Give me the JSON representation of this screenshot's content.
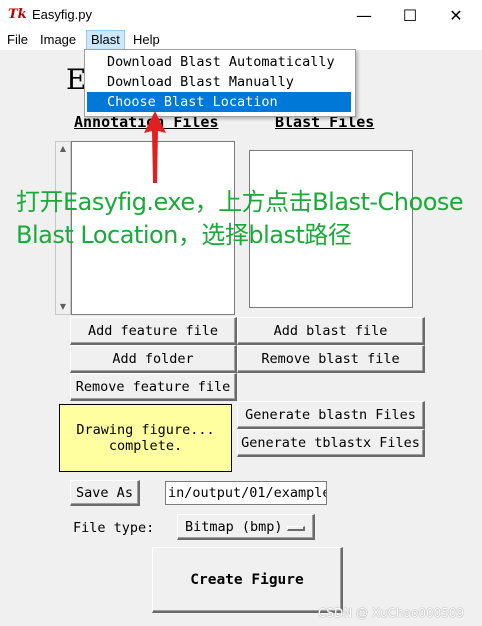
{
  "window": {
    "app_icon": "Tk",
    "title": "Easyfig.py",
    "minimize": "—",
    "maximize": "☐",
    "close": "✕"
  },
  "menubar": {
    "items": [
      "File",
      "Image",
      "Blast",
      "Help"
    ],
    "active": "Blast"
  },
  "blast_menu": {
    "items": [
      "Download Blast Automatically",
      "Download Blast Manually",
      "Choose Blast Location"
    ],
    "selected": "Choose Blast Location"
  },
  "main": {
    "title_partial": "E",
    "annotation_header": "Annotation Files",
    "blast_header": "Blast Files",
    "scroll_up": "▲",
    "scroll_down": "▼"
  },
  "buttons": {
    "add_feature_file": "Add feature file",
    "add_blast_file": "Add blast file",
    "add_folder": "Add folder",
    "remove_blast_file": "Remove blast file",
    "remove_feature_file": "Remove feature file",
    "generate_blastn": "Generate blastn Files",
    "generate_tblastx": "Generate tblastx Files",
    "save_as": "Save As",
    "create_figure": "Create Figure"
  },
  "status": {
    "line1": "Drawing figure...",
    "line2": "complete."
  },
  "save_path": "in/output/01/example",
  "file_type": {
    "label": "File type:",
    "selected": "Bitmap (bmp)"
  },
  "annotation_overlay": {
    "text": "打开Easyfig.exe，上方点击Blast-Choose\nBlast Location，选择blast路径",
    "color": "#1aaa3a",
    "arrow_color": "#e02020"
  },
  "watermark": "CSDN @ XuChao000509",
  "colors": {
    "status_bg": "#ffffa0",
    "menu_selected": "#0078d7"
  }
}
